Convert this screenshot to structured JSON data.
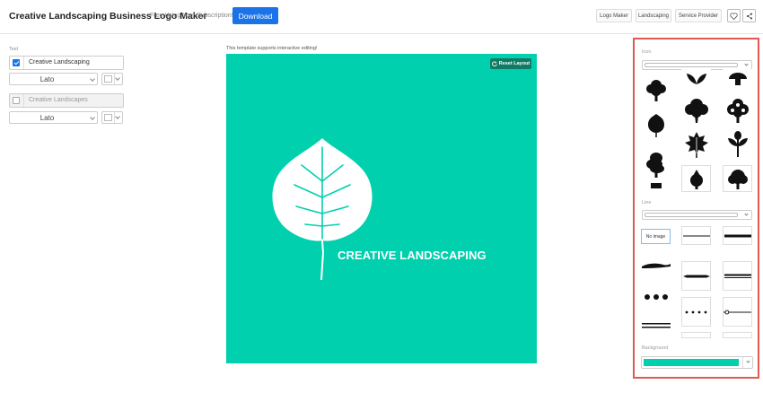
{
  "header": {
    "title": "Creative Landscaping Business Logo Maker",
    "subtitle": "Free Using Your Subscription!",
    "download_label": "Download",
    "tags": [
      "Logo Maker",
      "Landscaping",
      "Service Provider"
    ],
    "favorite_icon": "heart-icon",
    "share_icon": "share-icon"
  },
  "left_panel": {
    "section_label": "Text",
    "line1": {
      "checked": true,
      "value": "Creative Landscaping",
      "font": "Lato"
    },
    "line2": {
      "checked": false,
      "placeholder": "Creative Landscapes",
      "font": "Lato"
    }
  },
  "canvas": {
    "note": "This template supports interactive editing!",
    "reset_label": "Reset Layout",
    "brand_text": "CREATIVE LANDSCAPING",
    "background_color": "#00d0ad"
  },
  "right_panel": {
    "icon_label": "Icon",
    "line_label": "Line",
    "no_image_label": "No image",
    "background_label": "Background",
    "background_color": "#00d0ad",
    "icon_tiles": [
      "tree-icon",
      "leaves-icon",
      "mushroom-icon",
      "tree-icon",
      "tree-icon",
      "tree-icon",
      "leaf-icon",
      "maple-leaf-icon",
      "plant-icon",
      "tree-icon",
      "tree-icon",
      "tree-icon"
    ],
    "line_styles": [
      "none",
      "thin-line",
      "thick-line",
      "wave-line",
      "tapered-line",
      "double-line",
      "dot-line",
      "small-dots-line",
      "ring-line",
      "triple-line"
    ]
  }
}
